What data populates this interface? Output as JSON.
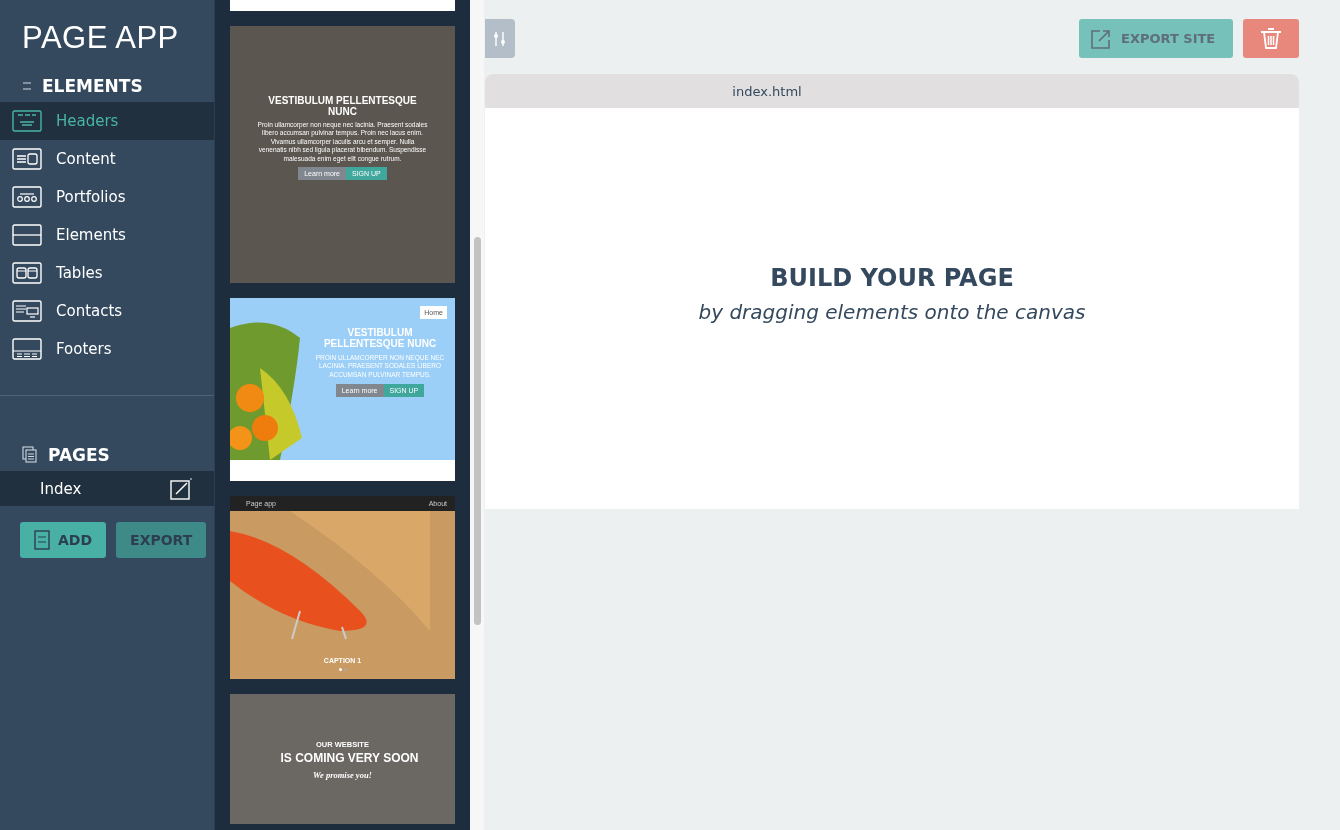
{
  "app": {
    "logo": "PAGE APP"
  },
  "elements_section": {
    "title": "ELEMENTS",
    "items": [
      {
        "label": "Headers",
        "kind": "headers",
        "selected": true
      },
      {
        "label": "Content",
        "kind": "content",
        "selected": false
      },
      {
        "label": "Portfolios",
        "kind": "portfolios",
        "selected": false
      },
      {
        "label": "Elements",
        "kind": "elements",
        "selected": false
      },
      {
        "label": "Tables",
        "kind": "tables",
        "selected": false
      },
      {
        "label": "Contacts",
        "kind": "contacts",
        "selected": false
      },
      {
        "label": "Footers",
        "kind": "footers",
        "selected": false
      }
    ]
  },
  "pages_section": {
    "title": "PAGES",
    "pages": [
      {
        "label": "Index",
        "selected": true
      }
    ],
    "buttons": [
      {
        "label": "ADD",
        "kind": "add"
      },
      {
        "label": "EXPORT",
        "kind": "export"
      }
    ]
  },
  "thumbnails": [
    {
      "kind": "blank"
    },
    {
      "kind": "overlay",
      "heading": "VESTIBULUM PELLENTESQUE NUNC",
      "body": "Proin ullamcorper non neque nec lacinia. Praesent sodales libero accumsan pulvinar tempus. Proin nec lacus enim. Vivamus ullamcorper iaculis arcu et semper. Nulla venenatis nibh sed ligula placerat bibendum. Suspendisse malesuada enim eget elit congue rutrum.",
      "buttons": [
        "Learn more",
        "SIGN UP"
      ]
    },
    {
      "kind": "split",
      "nav": [
        "Home"
      ],
      "heading": "VESTIBULUM PELLENTESQUE NUNC",
      "body": "PROIN ULLAMCORPER NON NEQUE NEC LACINIA. PRAESENT SODALES LIBERO ACCUMSAN PULVINAR TEMPUS.",
      "buttons": [
        "Learn more",
        "SIGN UP"
      ]
    },
    {
      "kind": "slider",
      "brand": "Page app",
      "nav": [
        "About"
      ],
      "caption": "CAPTION 1"
    },
    {
      "kind": "coming-soon",
      "kicker": "OUR WEBSITE",
      "heading": "IS COMING VERY SOON",
      "tagline": "We promise you!"
    }
  ],
  "toolbar": {
    "export_label": "EXPORT SITE"
  },
  "canvas": {
    "tab": "index.html",
    "heading": "BUILD YOUR PAGE",
    "subheading": "by dragging elements onto the canvas"
  }
}
